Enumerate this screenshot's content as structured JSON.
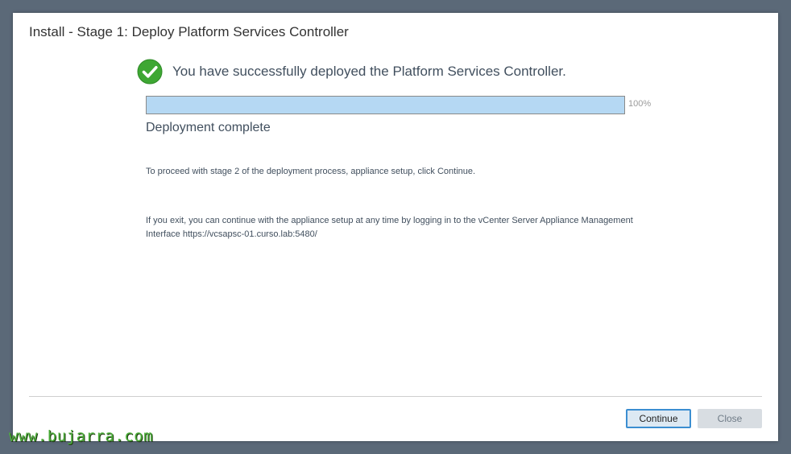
{
  "dialog": {
    "title": "Install - Stage 1: Deploy Platform Services Controller",
    "success_message": "You have successfully deployed the Platform Services Controller.",
    "progress": {
      "value_percent": 100,
      "label": "100%"
    },
    "status": "Deployment complete",
    "info_continue": "To proceed with stage 2 of the deployment process, appliance setup, click Continue.",
    "info_exit": "If you exit, you can continue with the appliance setup at any time by logging in to the vCenter Server Appliance Management Interface https://vcsapsc-01.curso.lab:5480/",
    "buttons": {
      "continue_label": "Continue",
      "close_label": "Close"
    }
  },
  "icons": {
    "success": "check-circle-icon"
  },
  "colors": {
    "success_green": "#3ea733",
    "progress_fill": "#b5d8f3",
    "primary_button_border": "#3b8ed1"
  },
  "watermark": "www.bujarra.com"
}
